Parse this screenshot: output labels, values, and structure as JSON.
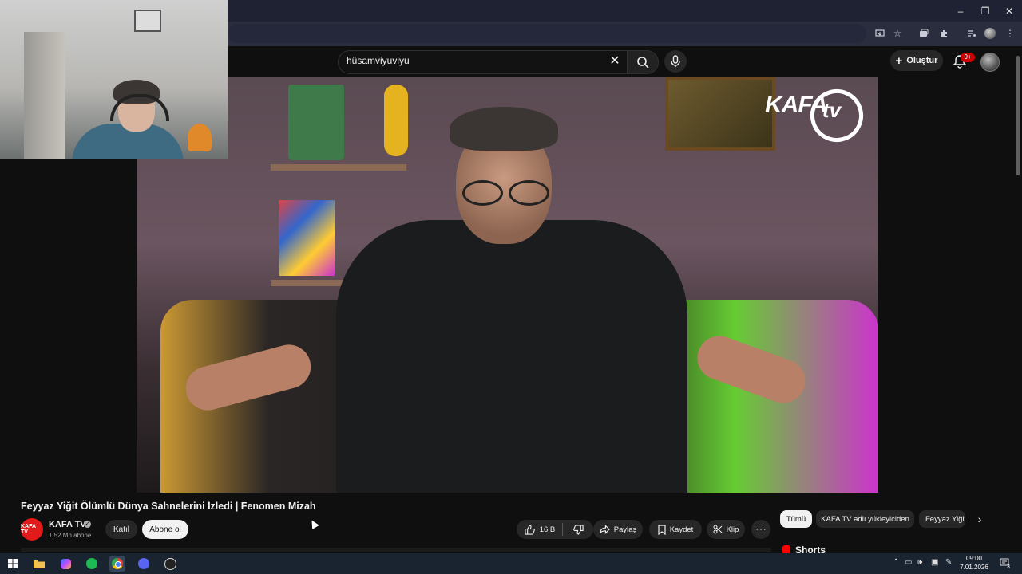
{
  "browser": {
    "window_controls": {
      "minimize": "–",
      "restore": "❐",
      "close": "✕"
    },
    "toolbar_icons": [
      "install-icon",
      "star-icon",
      "tab-search-icon",
      "extensions-icon",
      "media-icon",
      "profile-icon",
      "menu-icon"
    ]
  },
  "youtube": {
    "search": {
      "value": "hüsamviyuviyu",
      "clear": "✕"
    },
    "create_label": "Oluştur",
    "notification_badge": "9+"
  },
  "video": {
    "logo_text": "KAFA",
    "logo_suffix": "tv",
    "title": "Feyyaz Yiğit Ölümlü Dünya Sahnelerini İzledi | Fenomen Mizah"
  },
  "channel": {
    "avatar_text": "KAFA TV",
    "name": "KAFA TV",
    "verified": "✓",
    "subscribers": "1,52 Mn abone",
    "join_label": "Katıl",
    "subscribe_label": "Abone ol"
  },
  "actions": {
    "likes": "16 B",
    "share": "Paylaş",
    "save": "Kaydet",
    "clip": "Klip",
    "more": "⋯"
  },
  "chips": [
    "Tümü",
    "KAFA TV adlı yükleyiciden",
    "Feyyaz Yiğit"
  ],
  "shorts_label": "Shorts",
  "taskbar": {
    "apps": [
      "start-icon",
      "file-explorer-icon",
      "copilot-icon",
      "spotify-icon",
      "chrome-icon",
      "discord-icon",
      "obs-icon"
    ],
    "time": "09:00",
    "date": "7.01.2026",
    "notification_count": "3"
  },
  "colors": {
    "background": "#0f0f0f",
    "chip_active": "#f1f1f1",
    "subscribe": "#f1f1f1",
    "badge": "#cc0000",
    "spotify": "#1db954",
    "taskbar": "#1a2330"
  }
}
